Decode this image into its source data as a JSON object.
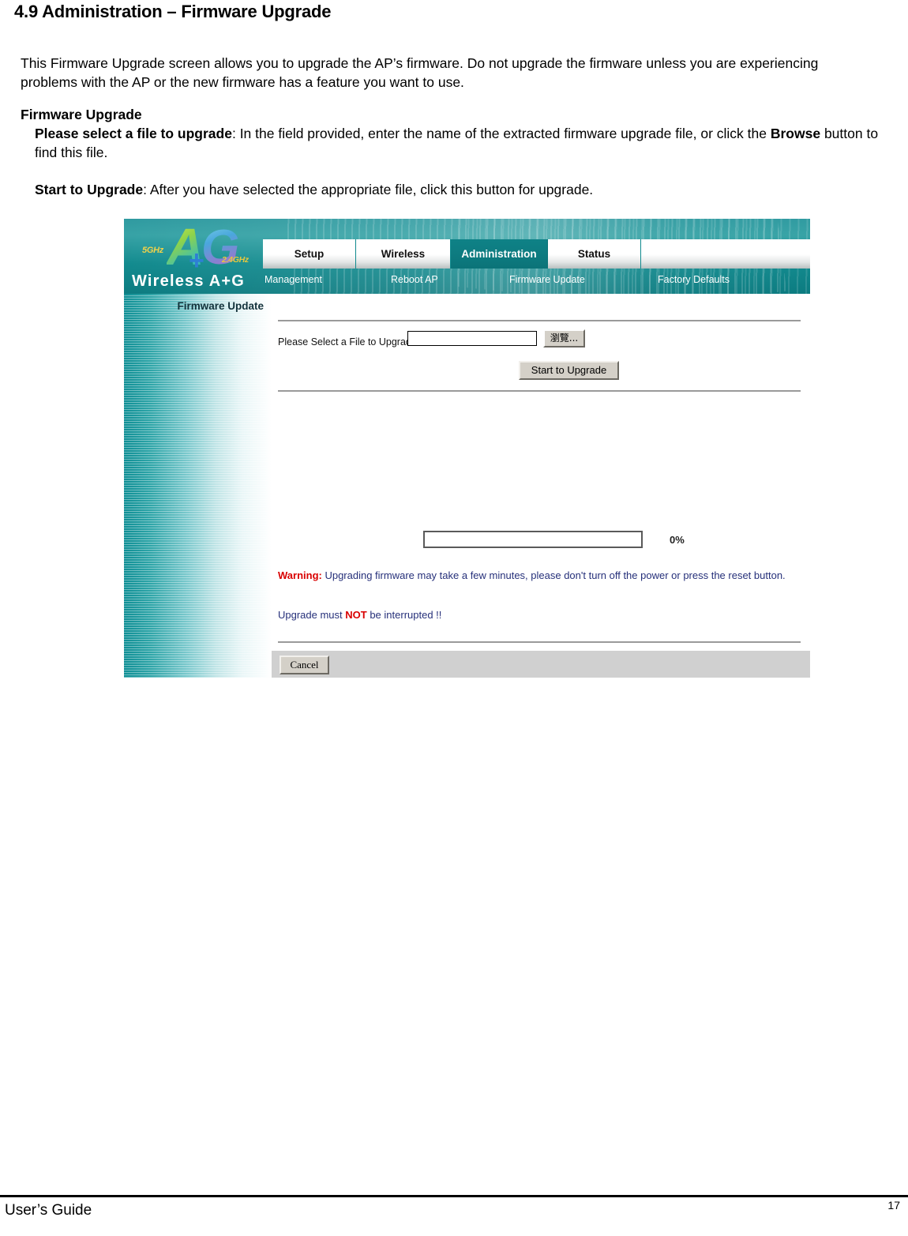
{
  "document": {
    "heading": "4.9 Administration – Firmware Upgrade",
    "intro": "This Firmware Upgrade screen allows you to upgrade the AP’s firmware. Do not upgrade the firmware unless you are experiencing problems with the AP or the new firmware has a feature you want to use.",
    "section_heading": "Firmware Upgrade",
    "please_select_bold": "Please select a file to upgrade",
    "please_select_rest": ": In the field provided, enter the name of the extracted firmware upgrade file, or click the ",
    "browse_bold": "Browse",
    "please_select_tail": " button to find this file.",
    "start_bold": "Start to Upgrade",
    "start_rest": ": After you have selected the appropriate file, click this button for upgrade."
  },
  "footer": {
    "left": "User’s Guide",
    "page_number": "17"
  },
  "screenshot": {
    "logo": {
      "letter_a": "A",
      "letter_g": "G",
      "plus": "+",
      "band_5ghz": "5GHz",
      "band_24ghz": "2.4GHz",
      "product_name": "Wireless A+G"
    },
    "tabs": [
      {
        "label": "Setup",
        "active": false
      },
      {
        "label": "Wireless",
        "active": false
      },
      {
        "label": "Administration",
        "active": true
      },
      {
        "label": "Status",
        "active": false
      }
    ],
    "subnav": [
      {
        "label": "Management"
      },
      {
        "label": "Reboot AP"
      },
      {
        "label": "Firmware Update"
      },
      {
        "label": "Factory Defaults"
      }
    ],
    "sidebar": {
      "title": "Firmware Update"
    },
    "form": {
      "file_label": "Please Select a File to Upgrade:",
      "file_value": "",
      "file_placeholder": "",
      "browse_label": "瀏覽...",
      "upgrade_label": "Start to Upgrade"
    },
    "progress": {
      "percent_label": "0%",
      "percent_value": 0
    },
    "warning": {
      "prefix": "Warning:",
      "text": " Upgrading firmware may take a few minutes, please don't turn off the power or press the reset button.",
      "line2_pre": "Upgrade must ",
      "line2_strong": "NOT",
      "line2_post": " be interrupted !!"
    },
    "actions": {
      "cancel_label": "Cancel"
    },
    "colors": {
      "teal": "#0f8287",
      "teal_dark": "#0b7378",
      "warning_red": "#d90000",
      "warning_blue": "#26307a",
      "button_face": "#d4d0c8",
      "footer_gray": "#d0d0d0"
    }
  }
}
